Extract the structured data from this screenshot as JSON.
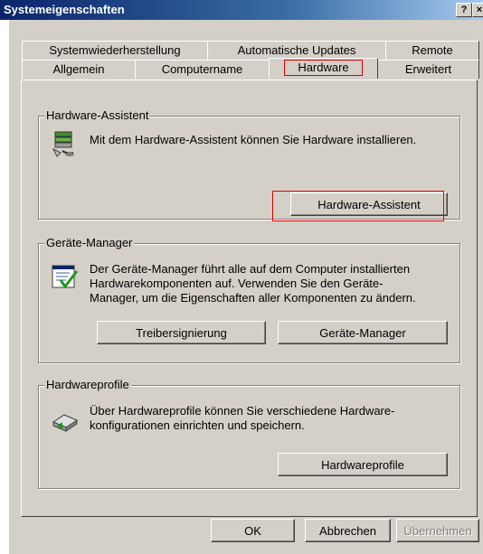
{
  "window": {
    "title": "Systemeigenschaften",
    "help_glyph": "?",
    "close_glyph": "×"
  },
  "tabs": {
    "row1": [
      "Systemwiederherstellung",
      "Automatische Updates",
      "Remote"
    ],
    "row2": [
      "Allgemein",
      "Computername",
      "Hardware",
      "Erweitert"
    ],
    "active": "Hardware"
  },
  "hardware_wizard": {
    "title": "Hardware-Assistent",
    "text": "Mit dem Hardware-Assistent können Sie Hardware installieren.",
    "button": "Hardware-Assistent",
    "icon": "hardware-wizard-icon"
  },
  "device_manager": {
    "title": "Geräte-Manager",
    "text_lines": [
      "Der Geräte-Manager führt alle auf dem Computer installierten",
      "Hardwarekomponenten auf. Verwenden Sie den Geräte-",
      "Manager, um die Eigenschaften aller Komponenten zu ändern."
    ],
    "button_signing": "Treibersignierung",
    "button_manager": "Geräte-Manager",
    "icon": "device-manager-icon"
  },
  "hardware_profiles": {
    "title": "Hardwareprofile",
    "text_lines": [
      "Über Hardwareprofile können Sie verschiedene Hardware-",
      "konfigurationen einrichten und speichern."
    ],
    "button": "Hardwareprofile",
    "icon": "hardware-profiles-icon"
  },
  "footer": {
    "ok": "OK",
    "cancel": "Abbrechen",
    "apply": "Übernehmen"
  },
  "colors": {
    "dialog_bg": "#d4d0c8",
    "highlight": "#e00000",
    "titlebar": "#0a246a"
  }
}
